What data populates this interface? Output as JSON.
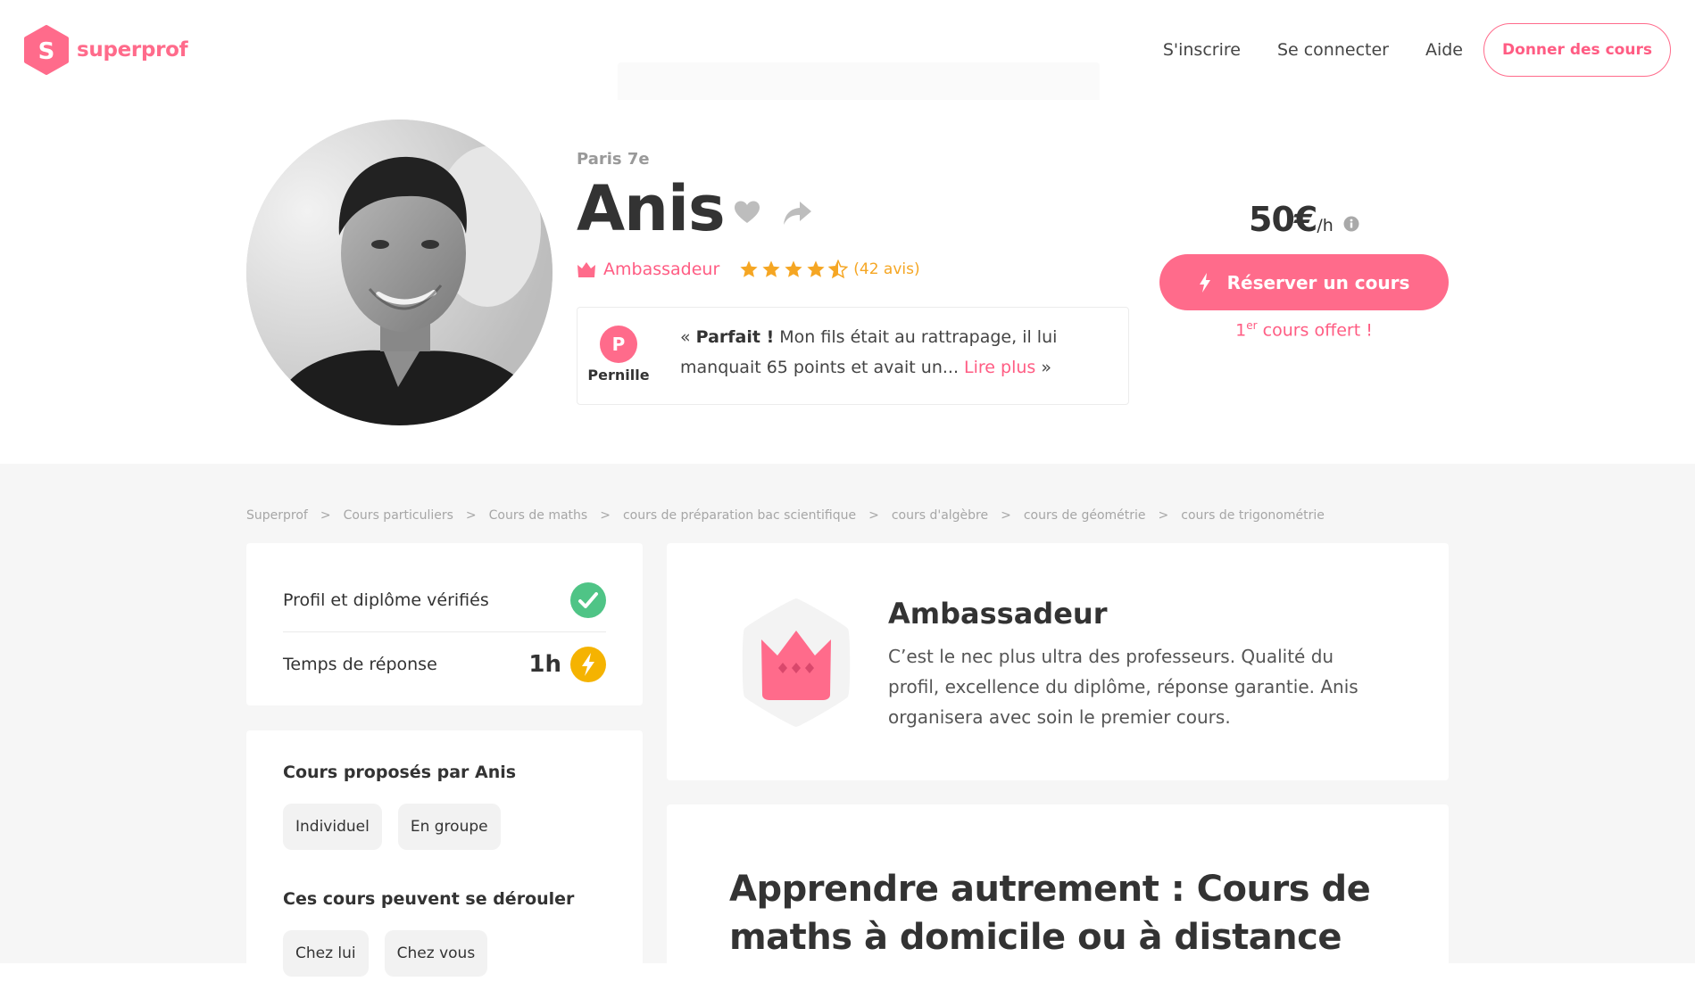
{
  "brand": {
    "name": "superprof",
    "logo_letter": "S",
    "color": "#ff6b8b"
  },
  "nav": {
    "signup": "S'inscrire",
    "login": "Se connecter",
    "help": "Aide",
    "teach": "Donner des cours"
  },
  "profile": {
    "city": "Paris 7e",
    "name": "Anis",
    "status": "Ambassadeur",
    "rating": 4.5,
    "reviews_count": "(42 avis)",
    "favorite_icon": "heart-icon",
    "share_icon": "share-icon"
  },
  "review": {
    "reviewer_initial": "P",
    "reviewer_name": "Pernille",
    "open_quote": "« ",
    "highlight": "Parfait !",
    "text": " Mon fils était au rattrapage, il lui manquait 65 points et avait un... ",
    "read_more": "Lire plus",
    "close_quote": " »"
  },
  "pricing": {
    "price": "50€",
    "unit": "/h",
    "book_label": "Réserver un cours",
    "offer_prefix": "1",
    "offer_sup": "er",
    "offer_text": " cours offert !"
  },
  "breadcrumb": [
    "Superprof",
    "Cours particuliers",
    "Cours de maths",
    "cours de préparation bac scientifique",
    "cours d'algèbre",
    "cours de géométrie",
    "cours de trigonométrie"
  ],
  "breadcrumb_separator": ">",
  "verification": {
    "verified_label": "Profil et diplôme vérifiés",
    "response_label": "Temps de réponse",
    "response_time": "1h"
  },
  "courses": {
    "title": "Cours proposés par Anis",
    "formats": [
      "Individuel",
      "En groupe"
    ],
    "places_title": "Ces cours peuvent se dérouler",
    "places": [
      "Chez lui",
      "Chez vous"
    ]
  },
  "ambassador": {
    "title": "Ambassadeur",
    "description": "C’est le nec plus ultra des professeurs. Qualité du profil, excellence du diplôme, réponse garantie. Anis organisera avec soin le premier cours."
  },
  "about": {
    "title": "Apprendre autrement : Cours de maths à domicile ou à distance"
  },
  "colors": {
    "accent": "#ff6b8b",
    "star": "#f5a623",
    "verified": "#4fc486",
    "background_gray": "#f6f6f6"
  }
}
